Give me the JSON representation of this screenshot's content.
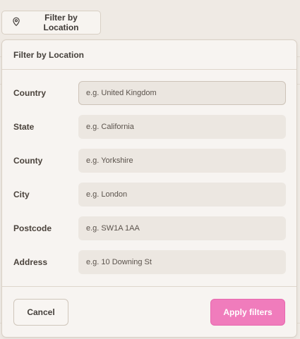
{
  "trigger": {
    "label": "Filter by Location",
    "icon": "map-pin-icon"
  },
  "popover": {
    "title": "Filter by Location",
    "fields": [
      {
        "label": "Country",
        "placeholder": "e.g. United Kingdom",
        "value": ""
      },
      {
        "label": "State",
        "placeholder": "e.g. California",
        "value": ""
      },
      {
        "label": "County",
        "placeholder": "e.g. Yorkshire",
        "value": ""
      },
      {
        "label": "City",
        "placeholder": "e.g. London",
        "value": ""
      },
      {
        "label": "Postcode",
        "placeholder": "e.g. SW1A 1AA",
        "value": ""
      },
      {
        "label": "Address",
        "placeholder": "e.g. 10 Downing St",
        "value": ""
      }
    ],
    "footer": {
      "cancel_label": "Cancel",
      "apply_label": "Apply filters"
    }
  },
  "colors": {
    "accent": "#f07cbc",
    "background": "#efeae4",
    "panel": "#f7f4f1",
    "input": "#ece7e1"
  }
}
